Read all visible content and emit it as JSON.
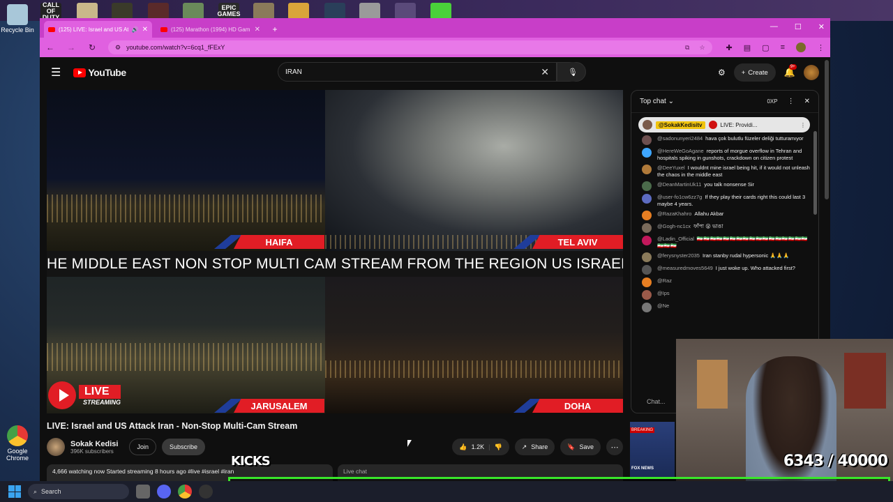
{
  "desktop": {
    "recycle_bin_label": "Recycle Bin",
    "chrome_label": "Google Chrome",
    "pinned_apps": [
      "CALL OF DUTY",
      "EPIC GAMES"
    ]
  },
  "browser": {
    "tabs": [
      {
        "title": "(125) LIVE: Israel and US Att",
        "active": true
      },
      {
        "title": "(125) Marathon (1994) HD Gam",
        "active": false
      }
    ],
    "url": "youtube.com/watch?v=6cq1_fFExY"
  },
  "youtube": {
    "logo_text": "YouTube",
    "search_value": "IRAN",
    "create_label": "Create",
    "notification_count": "9+",
    "video": {
      "ticker_text": "HE MIDDLE EAST NON STOP MULTI CAM STREAM FROM THE REGION US ISRAEL",
      "cities": [
        "HAIFA",
        "TEL AVIV",
        "JARUSALEM",
        "DOHA"
      ],
      "live_label": "LIVE",
      "streaming_label": "STREAMING"
    },
    "title": "LIVE: Israel and US Attack Iran - Non-Stop Multi-Cam Stream",
    "channel": {
      "name": "Sokak Kedisi",
      "subscribers": "396K subscribers",
      "join_label": "Join",
      "subscribe_label": "Subscribe"
    },
    "actions": {
      "likes": "1.2K",
      "share_label": "Share",
      "save_label": "Save"
    },
    "description_preview": "4,666 watching now  Started streaming 8 hours ago  #live #israel #iran",
    "live_chat_bar": "Live chat"
  },
  "chat": {
    "header": "Top chat",
    "xp_label": "0XP",
    "pinned": {
      "author": "@SokakKedisitv",
      "text": "LIVE: Providi..."
    },
    "messages": [
      {
        "author": "@sadonunyeri2484",
        "text": "hava çok bulutlu füzeler deliği tutturamıyor",
        "color": "#6d4f4f"
      },
      {
        "author": "@HereWeGoAgane",
        "text": "reports of morgue overflow in Tehran and hospitals spiking in gunshots, crackdown on citizen protest",
        "color": "#3ea6ff"
      },
      {
        "author": "@DeeYuxel",
        "text": "I wouldnt mine israel being hit, if it would not unleash the chaos in the middle east",
        "color": "#b07a3a"
      },
      {
        "author": "@DeanMartinUk11",
        "text": "you talk nonsense Sir",
        "color": "#4a6a4a"
      },
      {
        "author": "@user-fo1cw6zz7g",
        "text": "If they play their cards right this could last 3 maybe 4 years.",
        "color": "#5c6bc0"
      },
      {
        "author": "@RazaKhahro",
        "text": "Allahu Akbar",
        "color": "#e67e22"
      },
      {
        "author": "@Gogh-nc1cx",
        "text": "ফাঁপা 😮 ভাঙা",
        "color": "#7a6a5a"
      },
      {
        "author": "@Ladin_Official",
        "text": "🇮🇷🇮🇷🇮🇷🇮🇷🇮🇷🇮🇷🇮🇷🇮🇷🇮🇷🇮🇷🇮🇷🇮🇷🇮🇷🇮🇷🇮🇷🇮🇷🇮🇷🇮🇷🇮🇷🇮🇷",
        "color": "#c2185b"
      },
      {
        "author": "@ferysnyster2035",
        "text": "Iran stanby rudal hypersonic 🙏🙏🙏",
        "color": "#8a7a5a"
      },
      {
        "author": "@measuredmoves5649",
        "text": "I just woke up. Who attacked first?",
        "color": "#555555"
      },
      {
        "author": "@Raz",
        "text": "",
        "color": "#e67e22"
      },
      {
        "author": "@Ips",
        "text": "",
        "color": "#9a5a4a"
      },
      {
        "author": "@Ne",
        "text": "",
        "color": "#777777"
      }
    ],
    "input_placeholder": "Chat..."
  },
  "overlay": {
    "kicks_label": "KICKS",
    "counter": "6343  / 40000",
    "progress_current": 6343,
    "progress_goal": 40000,
    "breaking_label": "BREAKING",
    "fox_label": "FOX NEWS"
  },
  "taskbar": {
    "search_placeholder": "Search"
  }
}
